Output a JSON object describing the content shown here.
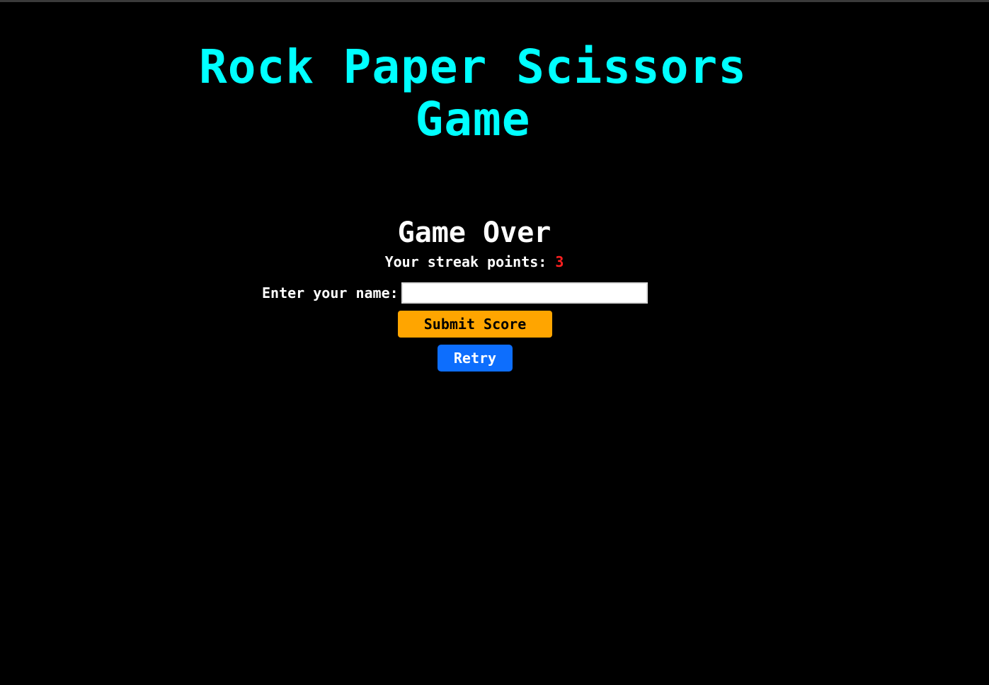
{
  "page": {
    "title_line1": "Rock Paper Scissors",
    "title_line2": "Game"
  },
  "game_over": {
    "heading": "Game Over",
    "streak_label": "Your streak points:",
    "streak_value": "3",
    "name_label": "Enter your name:",
    "name_value": "",
    "name_placeholder": "",
    "submit_label": "Submit Score",
    "retry_label": "Retry"
  },
  "colors": {
    "background": "#000000",
    "title": "#00ffff",
    "text": "#ffffff",
    "streak_value": "#ff2020",
    "submit_button": "#ffa500",
    "retry_button": "#0d6efd"
  }
}
